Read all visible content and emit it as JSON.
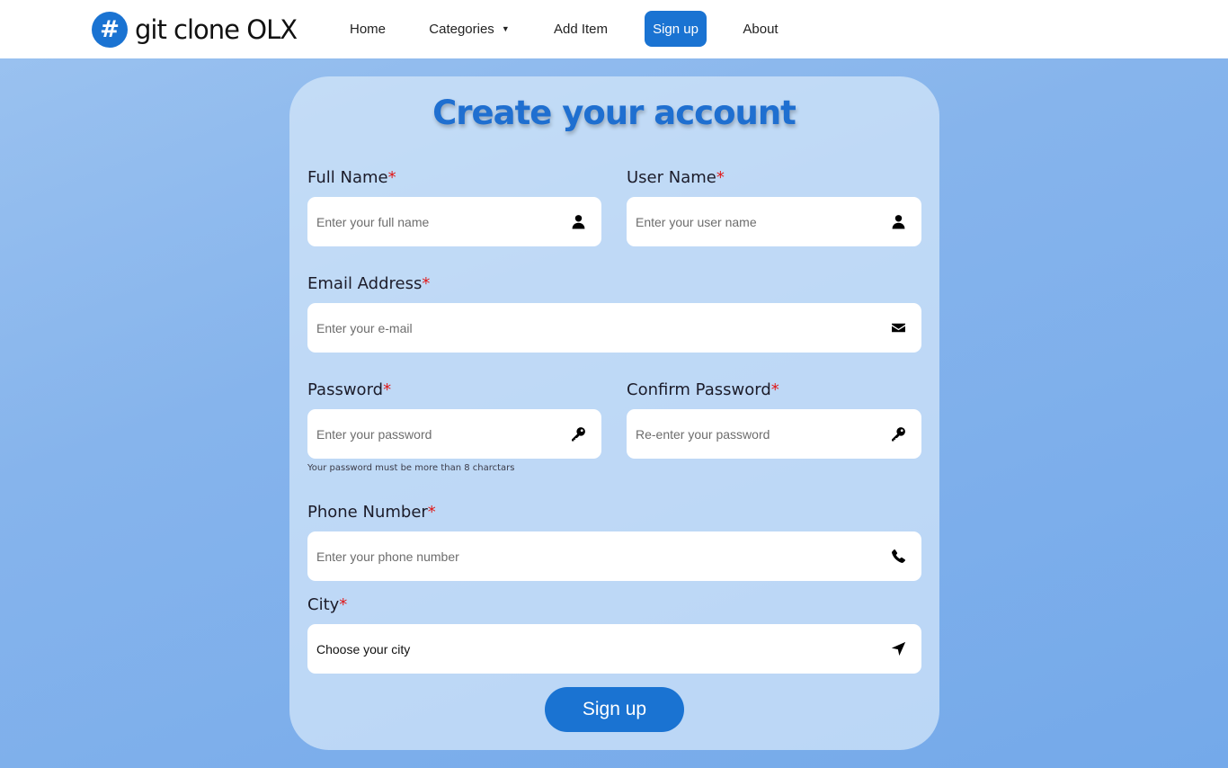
{
  "navbar": {
    "brand_symbol": "#",
    "brand_text": "git clone OLX",
    "links": {
      "home": "Home",
      "categories": "Categories",
      "categories_caret": "▼",
      "add_item": "Add Item",
      "signup": "Sign up",
      "about": "About"
    }
  },
  "form": {
    "title": "Create your account",
    "required_mark": "*",
    "full_name": {
      "label": "Full Name",
      "placeholder": "Enter your full name",
      "icon": "user-icon"
    },
    "user_name": {
      "label": "User Name",
      "placeholder": "Enter your user name",
      "icon": "user-icon"
    },
    "email": {
      "label": "Email Address",
      "placeholder": "Enter your e-mail",
      "icon": "envelope-icon"
    },
    "password": {
      "label": "Password",
      "placeholder": "Enter your password",
      "icon": "key-icon",
      "hint": "Your password must be more than 8 charctars"
    },
    "confirm_password": {
      "label": "Confirm Password",
      "placeholder": "Re-enter your password",
      "icon": "key-icon"
    },
    "phone": {
      "label": "Phone Number",
      "placeholder": "Enter your phone number",
      "icon": "phone-icon"
    },
    "city": {
      "label": "City",
      "selected": "Choose your city",
      "icon": "location-arrow-icon"
    },
    "submit_label": "Sign up"
  },
  "colors": {
    "accent": "#1a73d2",
    "required": "#e01919",
    "background": "#86b4ec"
  }
}
